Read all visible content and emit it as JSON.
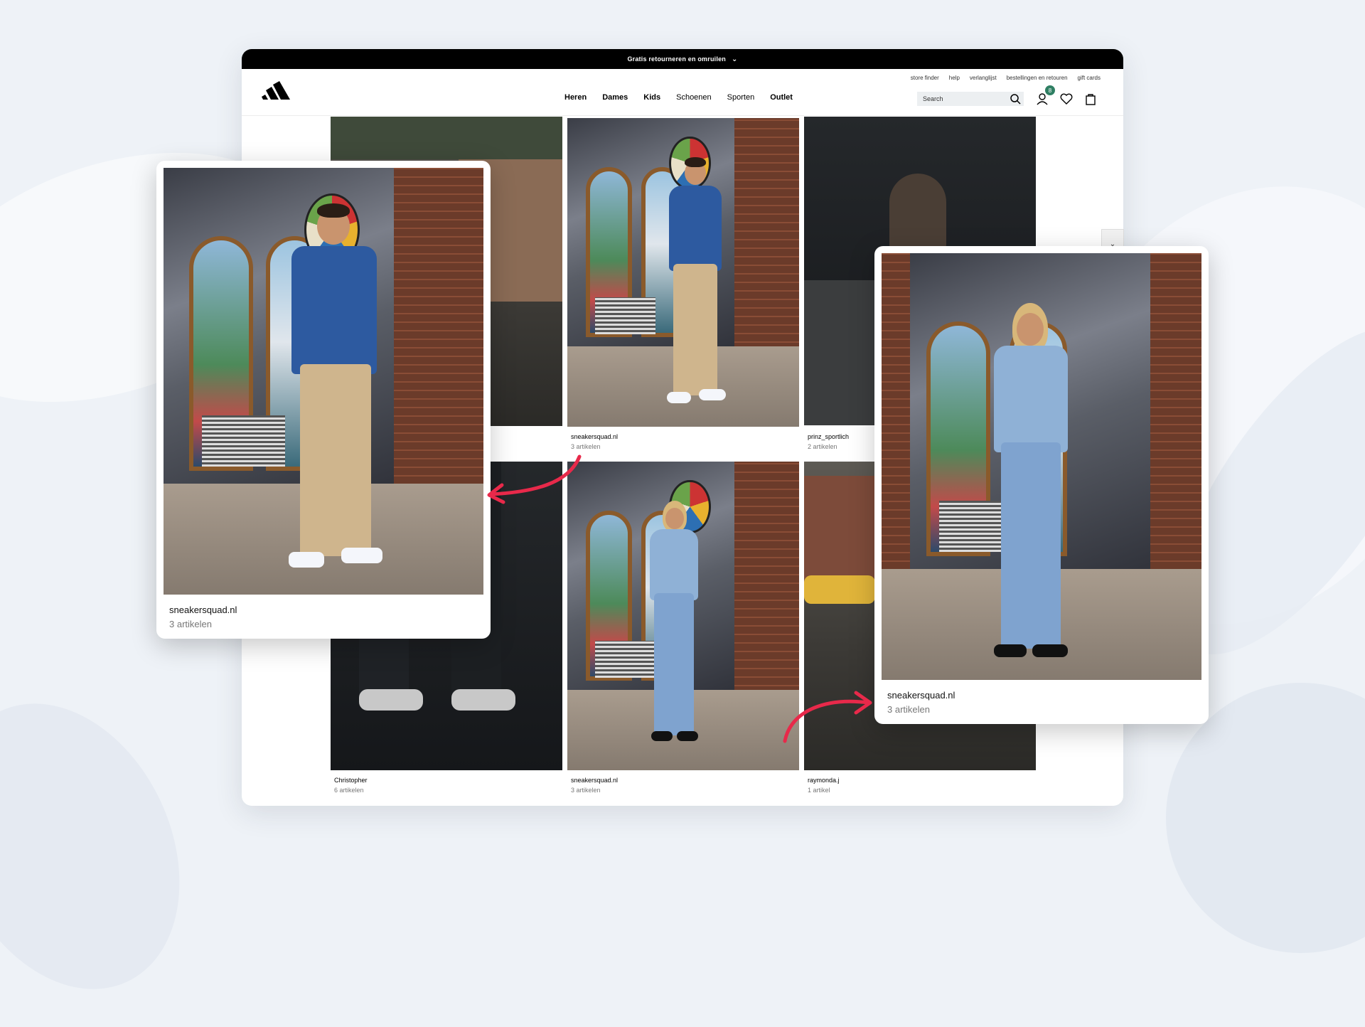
{
  "promo": {
    "text": "Gratis retourneren en omruilen",
    "chevron_icon": "chevron-down-icon"
  },
  "utility_links": [
    "store finder",
    "help",
    "verlanglijst",
    "bestellingen en retouren",
    "gift cards"
  ],
  "nav": {
    "items": [
      {
        "label": "Heren",
        "bold": true
      },
      {
        "label": "Dames",
        "bold": true
      },
      {
        "label": "Kids",
        "bold": true
      },
      {
        "label": "Schoenen",
        "bold": false
      },
      {
        "label": "Sporten",
        "bold": false
      },
      {
        "label": "Outlet",
        "bold": true
      }
    ]
  },
  "search": {
    "placeholder": "Search",
    "icon": "search-icon"
  },
  "header_icons": {
    "account_badge": "8",
    "account": "user-icon",
    "wishlist": "heart-icon",
    "bag": "bag-icon"
  },
  "gallery": {
    "items": [
      {
        "name": "",
        "count": ""
      },
      {
        "name": "sneakersquad.nl",
        "count": "3 artikelen"
      },
      {
        "name": "prinz_sportlich",
        "count": "2 artikelen"
      },
      {
        "name": "Christopher",
        "count": "6 artikelen"
      },
      {
        "name": "sneakersquad.nl",
        "count": "3 artikelen"
      },
      {
        "name": "raymonda.j",
        "count": "1 artikel"
      }
    ]
  },
  "cards": {
    "left": {
      "name": "sneakersquad.nl",
      "count": "3 artikelen"
    },
    "right": {
      "name": "sneakersquad.nl",
      "count": "3 artikelen"
    }
  },
  "colors": {
    "accent_arrow": "#e8294a",
    "badge": "#2f7f63",
    "promo_bg": "#000000"
  }
}
